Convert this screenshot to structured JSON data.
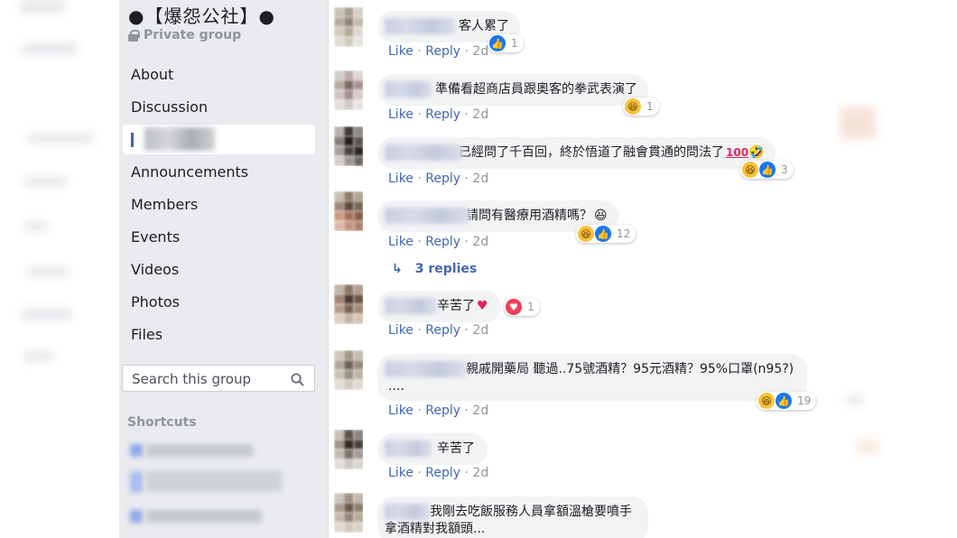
{
  "sidebar": {
    "group_name": "●【爆怨公社】●",
    "privacy": "Private group",
    "nav": [
      "About",
      "Discussion",
      "Announcements",
      "Members",
      "Events",
      "Videos",
      "Photos",
      "Files"
    ],
    "search_placeholder": "Search this group",
    "shortcuts_heading": "Shortcuts"
  },
  "comments": [
    {
      "text": "客人累了",
      "like": "Like",
      "reply": "Reply",
      "time": "2d",
      "reactions": [
        "like"
      ],
      "count": "1"
    },
    {
      "text": "準備看超商店員跟奧客的拳武表演了",
      "like": "Like",
      "reply": "Reply",
      "time": "2d",
      "reactions": [
        "haha"
      ],
      "count": "1"
    },
    {
      "text": "已經問了千百回，終於悟道了融會貫通的問法了",
      "emoji": "💯🤣",
      "like": "Like",
      "reply": "Reply",
      "time": "2d",
      "reactions": [
        "haha",
        "like"
      ],
      "count": "3"
    },
    {
      "text": "請問有醫療用酒精嗎？",
      "emoji": "😆",
      "like": "Like",
      "reply": "Reply",
      "time": "2d",
      "reactions": [
        "haha",
        "like"
      ],
      "count": "12"
    },
    {
      "text": "辛苦了",
      "emoji": "♥",
      "like": "Like",
      "reply": "Reply",
      "time": "2d",
      "reactions": [
        "love"
      ],
      "count": "1"
    },
    {
      "text": "親戚開藥局 聽過..75號酒精？95元酒精？95%口罩(n95?)",
      "line2": "....",
      "like": "Like",
      "reply": "Reply",
      "time": "2d",
      "reactions": [
        "haha",
        "like"
      ],
      "count": "19"
    },
    {
      "text": "辛苦了",
      "like": "Like",
      "reply": "Reply",
      "time": "2d"
    },
    {
      "text": "我剛去吃飯服務人員拿額溫槍要噴手",
      "line2": "拿酒精對我額頭..."
    }
  ],
  "replies_link": "3 replies",
  "colors": {
    "accent": "#4267b2",
    "sidebar_bg": "#e9ebee",
    "bubble_bg": "#f2f3f5",
    "meta": "#90949c"
  }
}
